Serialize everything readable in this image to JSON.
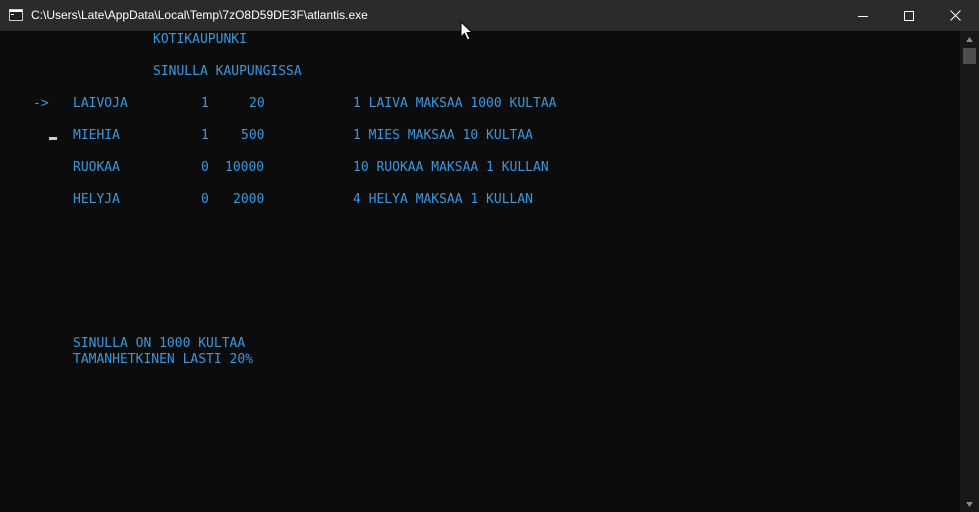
{
  "window": {
    "title": "C:\\Users\\Late\\AppData\\Local\\Temp\\7zO8D59DE3F\\atlantis.exe",
    "minimize_icon": "minimize-icon",
    "maximize_icon": "maximize-icon",
    "close_icon": "close-icon"
  },
  "console": {
    "heading": "KOTIKAUPUNKI",
    "subheading": "SINULLA KAUPUNGISSA",
    "selector": "->",
    "rows": [
      {
        "label": "LAIVOJA",
        "have": "1",
        "in_city": "20",
        "price": "1 LAIVA MAKSAA 1000 KULTAA"
      },
      {
        "label": "MIEHIA",
        "have": "1",
        "in_city": "500",
        "price": "1 MIES MAKSAA 10 KULTAA"
      },
      {
        "label": "RUOKAA",
        "have": "0",
        "in_city": "10000",
        "price": "10 RUOKAA MAKSAA 1 KULLAN"
      },
      {
        "label": "HELYJA",
        "have": "0",
        "in_city": "2000",
        "price": "4 HELYA MAKSAA 1 KULLAN"
      }
    ],
    "gold_line": "SINULLA ON 1000 KULTAA",
    "cargo_line": "TAMANHETKINEN LASTI 20%"
  },
  "colors": {
    "text": "#3a96dd",
    "background": "#0c0c0c",
    "titlebar": "#2b2b2b"
  }
}
